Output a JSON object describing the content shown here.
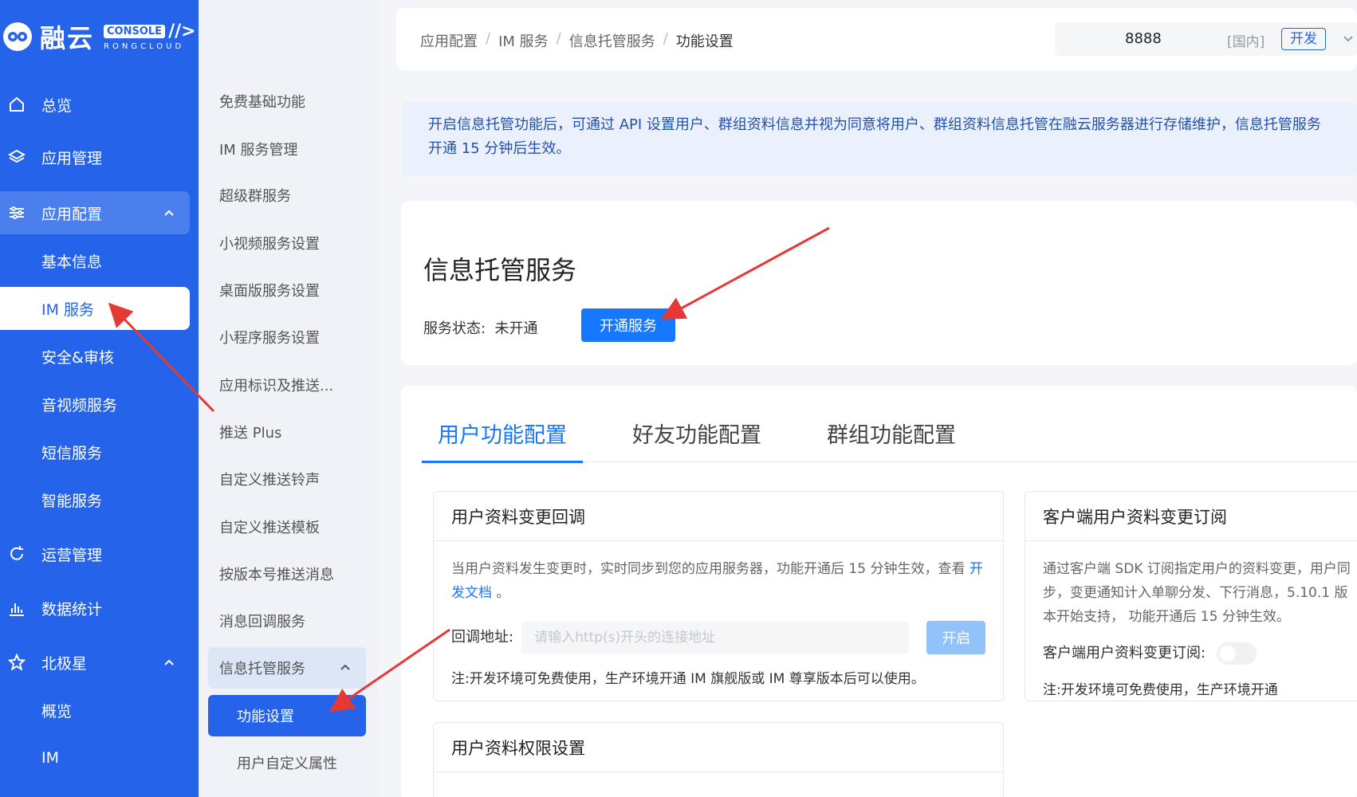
{
  "brand": {
    "name_cn": "融云",
    "console_label": "CONSOLE",
    "slash": "//>",
    "sub": "RONGCLOUD"
  },
  "nav": {
    "overview": "总览",
    "app_manage": "应用管理",
    "app_config": "应用配置",
    "basic_info": "基本信息",
    "im_service": "IM 服务",
    "security": "安全&审核",
    "av_service": "音视频服务",
    "sms_service": "短信服务",
    "smart_service": "智能服务",
    "ops_manage": "运营管理",
    "statistics": "数据统计",
    "polaris": "北极星",
    "polaris_overview": "概览",
    "polaris_im": "IM"
  },
  "subnav": {
    "items": [
      "免费基础功能",
      "IM 服务管理",
      "超级群服务",
      "小视频服务设置",
      "桌面版服务设置",
      "小程序服务设置",
      "应用标识及推送...",
      "推送 Plus",
      "自定义推送铃声",
      "自定义推送模板",
      "按版本号推送消息",
      "消息回调服务"
    ],
    "group": "信息托管服务",
    "active": "功能设置",
    "child": "用户自定义属性"
  },
  "header": {
    "breadcrumb": [
      "应用配置",
      "IM 服务",
      "信息托管服务",
      "功能设置"
    ],
    "app_id": "8888",
    "region": "[国内]",
    "env": "开发"
  },
  "notice": "开启信息托管功能后，可通过 API 设置用户、群组资料信息并视为同意将用户、群组资料信息托管在融云服务器进行存储维护，信息托管服务开通 15 分钟后生效。",
  "service": {
    "title": "信息托管服务",
    "status_label": "服务状态:",
    "status_value": "未开通",
    "open_button": "开通服务"
  },
  "tabs": [
    "用户功能配置",
    "好友功能配置",
    "群组功能配置"
  ],
  "panel_callback": {
    "title": "用户资料变更回调",
    "desc": "当用户资料发生变更时，实时同步到您的应用服务器，功能开通后 15 分钟生效，查看",
    "doc_link": "开发文档",
    "period": "。",
    "url_label": "回调地址:",
    "url_placeholder": "请输入http(s)开头的连接地址",
    "enable_button": "开启",
    "note": "注:开发环境可免费使用，生产环境开通 IM 旗舰版或 IM 尊享版本后可以使用。"
  },
  "panel_subscribe": {
    "title": "客户端用户资料变更订阅",
    "desc": "通过客户端 SDK 订阅指定用户的资料变更，用户同步，变更通知计入单聊分发、下行消息，5.10.1 版本开始支持， 功能开通后 15 分钟生效。",
    "toggle_label": "客户端用户资料变更订阅:",
    "note": "注:开发环境可免费使用，生产环境开通"
  },
  "panel_permission": {
    "title": "用户资料权限设置"
  }
}
